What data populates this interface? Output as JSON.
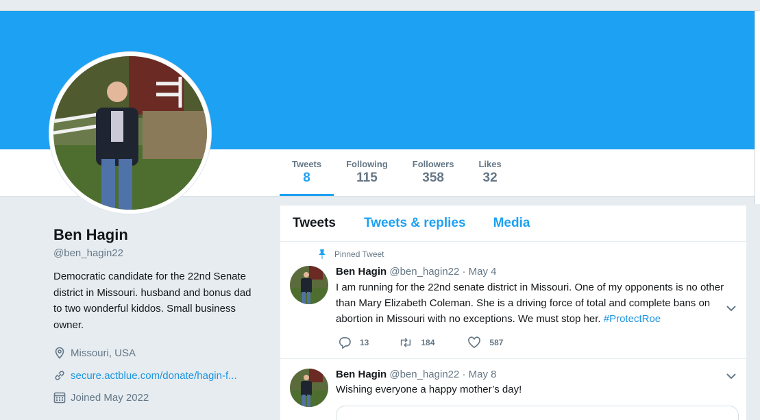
{
  "profile": {
    "name": "Ben Hagin",
    "handle": "@ben_hagin22",
    "bio": "Democratic candidate for the 22nd Senate district in Missouri. husband and bonus dad to two wonderful kiddos. Small business owner.",
    "location": "Missouri, USA",
    "website": "secure.actblue.com/donate/hagin-f...",
    "joined": "Joined May 2022"
  },
  "stats": [
    {
      "label": "Tweets",
      "value": "8"
    },
    {
      "label": "Following",
      "value": "115"
    },
    {
      "label": "Followers",
      "value": "358"
    },
    {
      "label": "Likes",
      "value": "32"
    }
  ],
  "tabs": [
    "Tweets",
    "Tweets & replies",
    "Media"
  ],
  "tweets": [
    {
      "pinned_label": "Pinned Tweet",
      "name": "Ben Hagin",
      "handle": "@ben_hagin22",
      "date": "· May 4",
      "text": "I am running for the 22nd senate district in Missouri.  One of my opponents is no other than Mary Elizabeth Coleman.  She is a driving force of total and complete bans on abortion in Missouri with no exceptions.  We must stop her. ",
      "hashtag": "#ProtectRoe",
      "replies": "13",
      "retweets": "184",
      "likes": "587"
    },
    {
      "name": "Ben Hagin",
      "handle": "@ben_hagin22",
      "date": "· May 8",
      "text": "Wishing everyone a happy mother’s day!"
    }
  ],
  "colors": {
    "accent": "#1da1f2",
    "link": "#1b95e0",
    "muted": "#657786",
    "background": "#e6ecf0"
  },
  "icons": [
    "location-pin-icon",
    "link-icon",
    "calendar-icon",
    "pin-icon",
    "chevron-down-icon",
    "reply-icon",
    "retweet-icon",
    "heart-icon"
  ]
}
